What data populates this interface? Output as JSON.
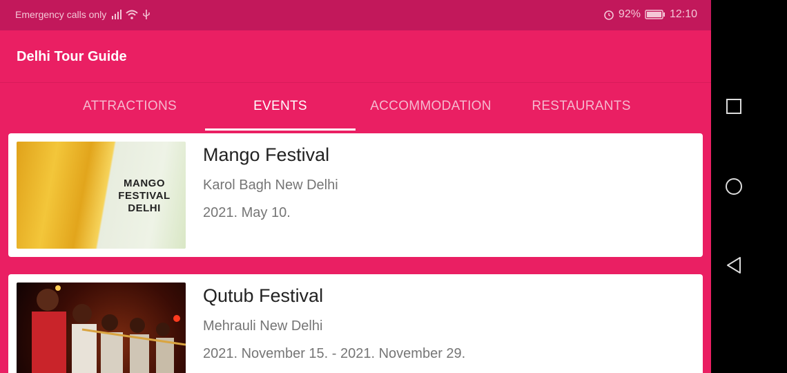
{
  "status_bar": {
    "carrier_text": "Emergency calls only",
    "battery_percent": "92%",
    "time": "12:10",
    "icons": [
      "signal-icon",
      "wifi-icon",
      "usb-icon",
      "alarm-icon",
      "battery-icon"
    ]
  },
  "app_bar": {
    "title": "Delhi Tour Guide"
  },
  "tabs": [
    {
      "label": "ATTRACTIONS",
      "active": false
    },
    {
      "label": "EVENTS",
      "active": true
    },
    {
      "label": "ACCOMMODATION",
      "active": false
    },
    {
      "label": "RESTAURANTS",
      "active": false
    }
  ],
  "events": [
    {
      "title": "Mango Festival",
      "location": "Karol Bagh New Delhi",
      "date": "2021. May 10.",
      "image_text": "MANGO FESTIVAL DELHI"
    },
    {
      "title": "Qutub Festival",
      "location": "Mehrauli New Delhi",
      "date": "2021. November 15. - 2021. November 29."
    }
  ],
  "nav_bar": {
    "buttons": [
      "recent-apps-icon",
      "home-icon",
      "back-icon"
    ]
  },
  "colors": {
    "primary": "#ea1f63",
    "primary_dark": "#c2185b",
    "card": "#ffffff",
    "nav_bar": "#000000"
  }
}
